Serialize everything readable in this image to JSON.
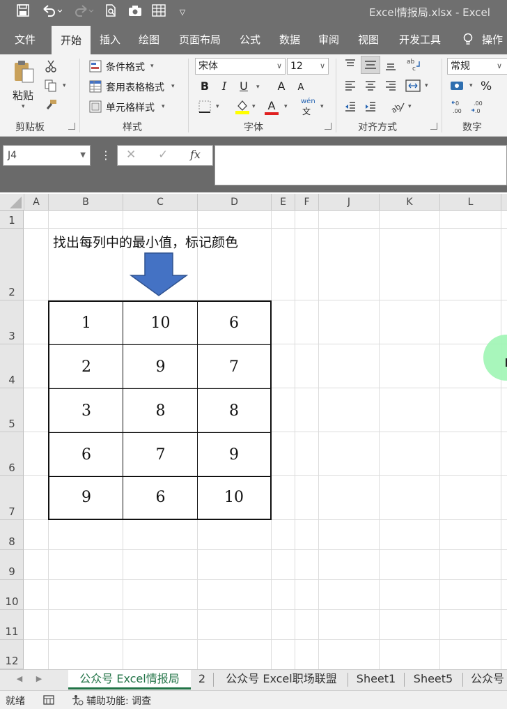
{
  "window": {
    "title": "Excel情报局.xlsx  -  Excel"
  },
  "ribbon_tabs": [
    "文件",
    "开始",
    "插入",
    "绘图",
    "页面布局",
    "公式",
    "数据",
    "审阅",
    "视图",
    "开发工具",
    "操作"
  ],
  "active_tab": "开始",
  "ribbon": {
    "clipboard": {
      "paste": "粘贴",
      "label": "剪贴板"
    },
    "styles": {
      "conditional": "条件格式",
      "table_format": "套用表格格式",
      "cell_styles": "单元格样式",
      "label": "样式"
    },
    "font": {
      "name": "宋体",
      "size": "12",
      "bold": "B",
      "italic": "I",
      "underline": "U",
      "grow": "A",
      "shrink": "A",
      "font_color": "A",
      "phonetic": "wén",
      "label": "字体"
    },
    "alignment": {
      "label": "对齐方式"
    },
    "number": {
      "format": "常规",
      "percent": "%",
      "label": "数字"
    }
  },
  "formula_bar": {
    "name_box": "J4",
    "cancel": "✕",
    "enter": "✓",
    "fx": "fx",
    "value": ""
  },
  "columns": [
    "A",
    "B",
    "C",
    "D",
    "E",
    "F",
    "J",
    "K",
    "L"
  ],
  "rows": [
    "1",
    "2",
    "3",
    "4",
    "5",
    "6",
    "7",
    "8",
    "9",
    "10",
    "11",
    "12"
  ],
  "sheet": {
    "caption": "找出每列中的最小值，标记颜色",
    "table": [
      [
        "1",
        "10",
        "6"
      ],
      [
        "2",
        "9",
        "7"
      ],
      [
        "3",
        "8",
        "8"
      ],
      [
        "6",
        "7",
        "9"
      ],
      [
        "9",
        "6",
        "10"
      ]
    ]
  },
  "sheet_tabs": [
    "公众号 Excel情报局",
    "2",
    "公众号 Excel职场联盟",
    "Sheet1",
    "Sheet5",
    "公众号"
  ],
  "active_sheet": "公众号 Excel情报局",
  "status": {
    "ready": "就绪",
    "accessibility": "辅助功能: 调查"
  },
  "colors": {
    "titlebar": "#6f6f6f",
    "ribbon": "#f3f3f3",
    "excel_green": "#217346",
    "arrow_blue": "#4472c4",
    "cursor_green": "#9ff5b4"
  }
}
